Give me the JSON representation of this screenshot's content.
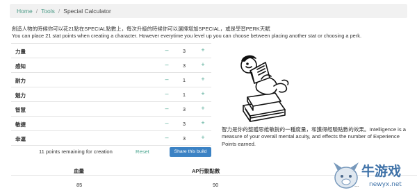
{
  "breadcrumb": {
    "home": "Home",
    "tools": "Tools",
    "current": "Special Calculator"
  },
  "intro": {
    "line1": "創造人物的時候你可以花21點在SPECIAL點數上，每次升級的時候你可以選擇增加SPECIAL，或是學習PERK天賦",
    "line2": "You can place 21 stat points when creating a character. However everytime you level up you can choose between placing another stat or choosing a perk."
  },
  "stats": [
    {
      "name": "力量",
      "value": "3",
      "minus": "–",
      "plus": "+"
    },
    {
      "name": "感知",
      "value": "3",
      "minus": "–",
      "plus": "+"
    },
    {
      "name": "耐力",
      "value": "1",
      "minus": "–",
      "plus": "+"
    },
    {
      "name": "魅力",
      "value": "1",
      "minus": "–",
      "plus": "+"
    },
    {
      "name": "智慧",
      "value": "3",
      "minus": "–",
      "plus": "+"
    },
    {
      "name": "敏捷",
      "value": "3",
      "minus": "–",
      "plus": "+"
    },
    {
      "name": "幸運",
      "value": "3",
      "minus": "–",
      "plus": "+"
    }
  ],
  "remaining": "11 points remaining for creation",
  "reset_label": "Reset",
  "share_label": "Share this build",
  "description": "智力是你的整體思維敏銳的一種度量，和獲得經驗點數的效果。Intelligence is a measure of your overall mental acuity, and effects the number of Experience Points earned.",
  "bottom_table": {
    "headers": [
      "血量",
      "AP行動點數",
      "..."
    ],
    "values": [
      "85",
      "90",
      "..."
    ]
  },
  "watermark": {
    "text": "牛游戏",
    "sub": "newyx.net"
  },
  "colors": {
    "accent": "#4aa58f",
    "button": "#3b82c4",
    "breadcrumb_bg": "#f1f1f1"
  }
}
